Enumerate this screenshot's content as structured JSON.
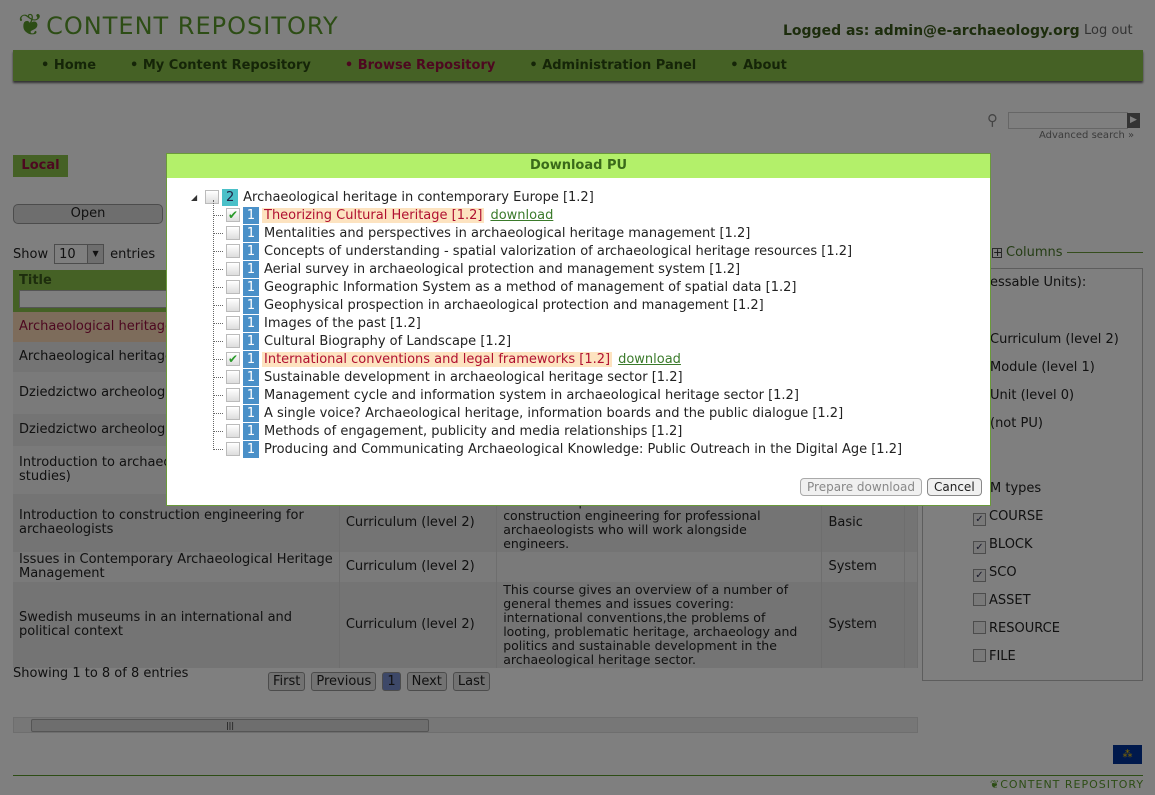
{
  "header": {
    "logo_text": "CONTENT REPOSITORY",
    "logged_as": "Logged as: admin@e-archaeology.org",
    "logout": "Log out"
  },
  "nav": [
    {
      "label": "Home"
    },
    {
      "label": "My Content Repository"
    },
    {
      "label": "Browse Repository",
      "active": true
    },
    {
      "label": "Administration Panel"
    },
    {
      "label": "About"
    }
  ],
  "search": {
    "value": "",
    "advanced": "Advanced search »"
  },
  "tab_local": "Local",
  "open_button": "Open",
  "show": {
    "prefix": "Show",
    "value": "10",
    "suffix": "entries"
  },
  "table": {
    "header_title": "Title",
    "rows": [
      {
        "title": "Archaeological heritage Europe",
        "type": "",
        "description": "",
        "level": "",
        "highlighted": true
      },
      {
        "title": "Archaeological heritage Europe (Second edition",
        "type": "",
        "description": "",
        "level": ""
      },
      {
        "title": "Dziedzictwo archeologic współczesnej Europie",
        "type": "",
        "description": "",
        "level": ""
      },
      {
        "title": "Dziedzictwo archeologic współczesnej Europie (",
        "type": "",
        "description": "",
        "level": ""
      },
      {
        "title": "Introduction to archaeo construction engineers studies)",
        "type": "",
        "description": "",
        "level": ""
      },
      {
        "title": "Introduction to construction engineering for archaeologists",
        "type": "Curriculum (level 2)",
        "description": "This course presents an introduction to construction engineering for professional archaeologists who will work alongside engineers.",
        "level": "Basic"
      },
      {
        "title": "Issues in Contemporary Archaeological Heritage Management",
        "type": "Curriculum (level 2)",
        "description": "",
        "level": "System"
      },
      {
        "title": "Swedish museums in an international and political context",
        "type": "Curriculum (level 2)",
        "description": "This course gives an overview of a number of general themes and issues covering: international conventions,the problems of looting, problematic heritage, archaeology and politics and sustainable development in the archaeological heritage sector.",
        "level": "System"
      }
    ]
  },
  "info": "Showing 1 to 8 of 8 entries",
  "pager": {
    "first": "First",
    "previous": "Previous",
    "current": "1",
    "next": "Next",
    "last": "Last"
  },
  "panel": {
    "columns_label": "Columns",
    "pu_heading": "essable Units):",
    "levels": [
      "Curriculum (level 2)",
      "Module (level 1)",
      "Unit (level 0)",
      "(not PU)"
    ],
    "types_heading": "M types",
    "types": [
      {
        "label": "COURSE",
        "checked": true
      },
      {
        "label": "BLOCK",
        "checked": true
      },
      {
        "label": "SCO",
        "checked": true
      },
      {
        "label": "ASSET",
        "checked": false
      },
      {
        "label": "RESOURCE",
        "checked": false
      },
      {
        "label": "FILE",
        "checked": false
      }
    ]
  },
  "dialog": {
    "title": "Download PU",
    "root": {
      "level": "2",
      "label": "Archaeological heritage in contemporary Europe [1.2]"
    },
    "children": [
      {
        "level": "1",
        "label": "Theorizing Cultural Heritage [1.2]",
        "checked": true,
        "link": "download"
      },
      {
        "level": "1",
        "label": "Mentalities and perspectives in archaeological heritage management [1.2]",
        "checked": false
      },
      {
        "level": "1",
        "label": "Concepts of understanding - spatial valorization of archaeological heritage resources [1.2]",
        "checked": false
      },
      {
        "level": "1",
        "label": "Aerial survey in archaeological protection and management system [1.2]",
        "checked": false
      },
      {
        "level": "1",
        "label": "Geographic Information System as a method of management of spatial data [1.2]",
        "checked": false
      },
      {
        "level": "1",
        "label": "Geophysical prospection in archaeological protection and management [1.2]",
        "checked": false
      },
      {
        "level": "1",
        "label": "Images of the past [1.2]",
        "checked": false
      },
      {
        "level": "1",
        "label": "Cultural Biography of Landscape [1.2]",
        "checked": false
      },
      {
        "level": "1",
        "label": "International conventions and legal frameworks [1.2]",
        "checked": true,
        "link": "download"
      },
      {
        "level": "1",
        "label": "Sustainable development in archaeological heritage sector [1.2]",
        "checked": false
      },
      {
        "level": "1",
        "label": "Management cycle and information system in archaeological heritage sector [1.2]",
        "checked": false
      },
      {
        "level": "1",
        "label": "A single voice? Archaeological heritage, information boards and the public dialogue [1.2]",
        "checked": false
      },
      {
        "level": "1",
        "label": "Methods of engagement, publicity and media relationships [1.2]",
        "checked": false
      },
      {
        "level": "1",
        "label": "Producing and Communicating Archaeological Knowledge: Public Outreach in the Digital Age [1.2]",
        "checked": false
      }
    ],
    "prepare": "Prepare download",
    "cancel": "Cancel"
  },
  "footer": {
    "logo_text": "CONTENT REPOSITORY"
  }
}
